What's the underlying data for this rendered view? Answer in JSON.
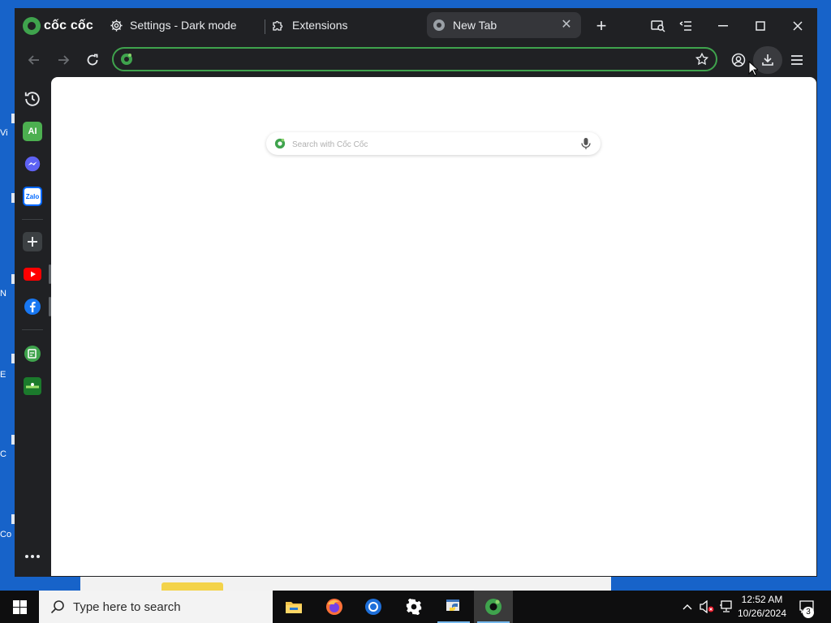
{
  "browser": {
    "brand": "cốc cốc",
    "tabs": [
      {
        "title": "Settings - Dark mode",
        "icon": "gear-icon",
        "active": false
      },
      {
        "title": "Extensions",
        "icon": "puzzle-icon",
        "active": false
      },
      {
        "title": "New Tab",
        "icon": "coccoc-icon",
        "active": true
      }
    ],
    "window_controls": [
      "tab-search-icon",
      "tab-list-icon",
      "minimize-icon",
      "maximize-icon",
      "close-icon"
    ],
    "omnibox": {
      "value": "",
      "placeholder": ""
    },
    "sidebar": [
      "history-icon",
      "ai-chat-icon",
      "messenger-icon",
      "zalo-icon",
      "add-icon",
      "youtube-icon",
      "facebook-icon",
      "notes-icon",
      "game-icon",
      "more-icon"
    ],
    "sidebar_labels": {
      "ai": "AI",
      "zalo": "Zalo"
    }
  },
  "new_tab": {
    "search_placeholder": "Search with Cốc Cốc"
  },
  "taskbar": {
    "search_placeholder": "Type here to search",
    "apps": [
      "file-explorer-icon",
      "firefox-icon",
      "chrome-icon",
      "settings-icon",
      "python-idle-icon",
      "coccoc-icon"
    ],
    "time": "12:52 AM",
    "date": "10/26/2024",
    "notification_count": "3"
  },
  "colors": {
    "accent": "#3fa34d",
    "chrome_bg": "#202124",
    "desktop": "#1763c9"
  }
}
